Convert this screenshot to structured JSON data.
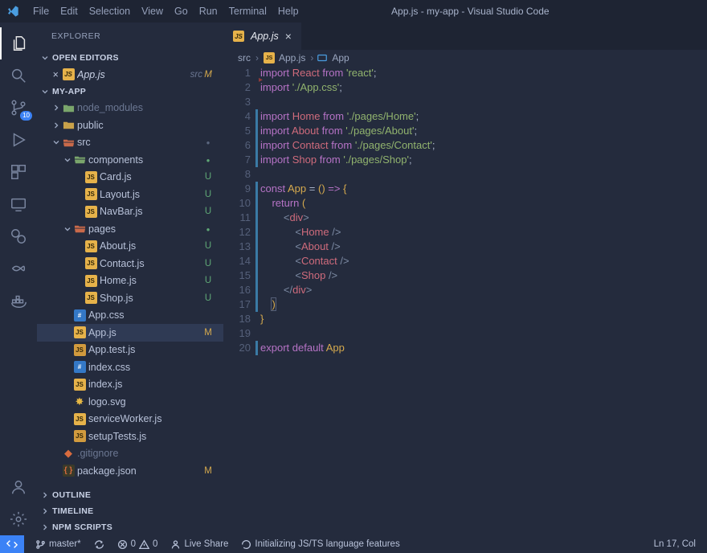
{
  "window": {
    "title": "App.js - my-app - Visual Studio Code"
  },
  "menubar": [
    "File",
    "Edit",
    "Selection",
    "View",
    "Go",
    "Run",
    "Terminal",
    "Help"
  ],
  "activitybar": {
    "scm_badge": "10",
    "items": [
      "explorer",
      "search",
      "scm",
      "run",
      "extensions",
      "remote",
      "cloud",
      "live-share",
      "docker"
    ],
    "bottom": [
      "accounts",
      "settings"
    ]
  },
  "sidebar": {
    "title": "EXPLORER",
    "sections": {
      "openEditors": "OPEN EDITORS",
      "project": "MY-APP",
      "outline": "OUTLINE",
      "timeline": "TIMELINE",
      "npm": "NPM SCRIPTS"
    },
    "openEditors": [
      {
        "name": "App.js",
        "desc": "src",
        "status": "M"
      }
    ],
    "tree": [
      {
        "d": 1,
        "c": "right",
        "ico": "folder-g",
        "lbl": "node_modules",
        "dim": true
      },
      {
        "d": 1,
        "c": "right",
        "ico": "folder-y",
        "lbl": "public"
      },
      {
        "d": 1,
        "c": "down",
        "ico": "folder-r-o",
        "lbl": "src",
        "badge": "dot"
      },
      {
        "d": 2,
        "c": "down",
        "ico": "folder-g-o",
        "lbl": "components",
        "badge": "gdot"
      },
      {
        "d": 3,
        "ico": "js",
        "lbl": "Card.js",
        "badge": "U"
      },
      {
        "d": 3,
        "ico": "js",
        "lbl": "Layout.js",
        "badge": "U"
      },
      {
        "d": 3,
        "ico": "js",
        "lbl": "NavBar.js",
        "badge": "U"
      },
      {
        "d": 2,
        "c": "down",
        "ico": "folder-r-o",
        "lbl": "pages",
        "badge": "gdot"
      },
      {
        "d": 3,
        "ico": "js",
        "lbl": "About.js",
        "badge": "U"
      },
      {
        "d": 3,
        "ico": "js",
        "lbl": "Contact.js",
        "badge": "U"
      },
      {
        "d": 3,
        "ico": "js",
        "lbl": "Home.js",
        "badge": "U"
      },
      {
        "d": 3,
        "ico": "js",
        "lbl": "Shop.js",
        "badge": "U"
      },
      {
        "d": 2,
        "ico": "css",
        "lbl": "App.css"
      },
      {
        "d": 2,
        "ico": "js",
        "lbl": "App.js",
        "badge": "M",
        "sel": true
      },
      {
        "d": 2,
        "ico": "jst",
        "lbl": "App.test.js"
      },
      {
        "d": 2,
        "ico": "css",
        "lbl": "index.css"
      },
      {
        "d": 2,
        "ico": "js",
        "lbl": "index.js"
      },
      {
        "d": 2,
        "ico": "star",
        "lbl": "logo.svg"
      },
      {
        "d": 2,
        "ico": "js",
        "lbl": "serviceWorker.js"
      },
      {
        "d": 2,
        "ico": "jst",
        "lbl": "setupTests.js"
      },
      {
        "d": 1,
        "ico": "git",
        "lbl": ".gitignore",
        "dim": true
      },
      {
        "d": 1,
        "ico": "json",
        "lbl": "package.json",
        "badge": "M"
      }
    ]
  },
  "tab": {
    "name": "App.js"
  },
  "breadcrumb": {
    "a": "src",
    "b": "App.js",
    "c": "App"
  },
  "code": {
    "bars": [
      [
        4,
        7
      ],
      [
        9,
        17
      ],
      [
        20,
        20
      ]
    ],
    "lines": [
      {
        "n": 1,
        "t": [
          [
            "kw",
            "import"
          ],
          [
            "",
            ""
          ],
          [
            "id",
            "React"
          ],
          [
            "",
            ""
          ],
          [
            "kw",
            "from"
          ],
          [
            "",
            ""
          ],
          [
            "str",
            "'react'"
          ],
          [
            "pn",
            ";"
          ]
        ]
      },
      {
        "n": 2,
        "t": [
          [
            "kw",
            "import"
          ],
          [
            "",
            ""
          ],
          [
            "str",
            "'./App.css'"
          ],
          [
            "pn",
            ";"
          ]
        ]
      },
      {
        "n": 3,
        "t": []
      },
      {
        "n": 4,
        "t": [
          [
            "kw",
            "import"
          ],
          [
            "",
            ""
          ],
          [
            "id",
            "Home"
          ],
          [
            "",
            ""
          ],
          [
            "kw",
            "from"
          ],
          [
            "",
            ""
          ],
          [
            "str",
            "'./pages/Home'"
          ],
          [
            "pn",
            ";"
          ]
        ]
      },
      {
        "n": 5,
        "t": [
          [
            "kw",
            "import"
          ],
          [
            "",
            ""
          ],
          [
            "id",
            "About"
          ],
          [
            "",
            ""
          ],
          [
            "kw",
            "from"
          ],
          [
            "",
            ""
          ],
          [
            "str",
            "'./pages/About'"
          ],
          [
            "pn",
            ";"
          ]
        ]
      },
      {
        "n": 6,
        "t": [
          [
            "kw",
            "import"
          ],
          [
            "",
            ""
          ],
          [
            "id",
            "Contact"
          ],
          [
            "",
            ""
          ],
          [
            "kw",
            "from"
          ],
          [
            "",
            ""
          ],
          [
            "str",
            "'./pages/Contact'"
          ],
          [
            "pn",
            ";"
          ]
        ]
      },
      {
        "n": 7,
        "t": [
          [
            "kw",
            "import"
          ],
          [
            "",
            ""
          ],
          [
            "id",
            "Shop"
          ],
          [
            "",
            ""
          ],
          [
            "kw",
            "from"
          ],
          [
            "",
            ""
          ],
          [
            "str",
            "'./pages/Shop'"
          ],
          [
            "pn",
            ";"
          ]
        ]
      },
      {
        "n": 8,
        "t": []
      },
      {
        "n": 9,
        "t": [
          [
            "kw",
            "const"
          ],
          [
            "",
            ""
          ],
          [
            "fn",
            "App"
          ],
          [
            "",
            ""
          ],
          [
            "pn",
            "="
          ],
          [
            "",
            ""
          ],
          [
            "par",
            "("
          ],
          [
            "par",
            ")"
          ],
          [
            "",
            ""
          ],
          [
            "op",
            "=>"
          ],
          [
            "",
            ""
          ],
          [
            "par",
            "{"
          ]
        ]
      },
      {
        "n": 10,
        "i": 4,
        "t": [
          [
            "kw",
            "return"
          ],
          [
            "",
            ""
          ],
          [
            "par",
            "("
          ]
        ]
      },
      {
        "n": 11,
        "i": 8,
        "t": [
          [
            "tagb",
            "<"
          ],
          [
            "tag",
            "div"
          ],
          [
            "tagb",
            ">"
          ]
        ]
      },
      {
        "n": 12,
        "i": 12,
        "t": [
          [
            "tagb",
            "<"
          ],
          [
            "tag",
            "Home"
          ],
          [
            "",
            ""
          ],
          [
            "tagb",
            "/>"
          ]
        ]
      },
      {
        "n": 13,
        "i": 12,
        "t": [
          [
            "tagb",
            "<"
          ],
          [
            "tag",
            "About"
          ],
          [
            "",
            ""
          ],
          [
            "tagb",
            "/>"
          ]
        ]
      },
      {
        "n": 14,
        "i": 12,
        "t": [
          [
            "tagb",
            "<"
          ],
          [
            "tag",
            "Contact"
          ],
          [
            "",
            ""
          ],
          [
            "tagb",
            "/>"
          ]
        ]
      },
      {
        "n": 15,
        "i": 12,
        "t": [
          [
            "tagb",
            "<"
          ],
          [
            "tag",
            "Shop"
          ],
          [
            "",
            ""
          ],
          [
            "tagb",
            "/>"
          ]
        ]
      },
      {
        "n": 16,
        "i": 8,
        "t": [
          [
            "tagb",
            "</"
          ],
          [
            "tag",
            "div"
          ],
          [
            "tagb",
            ">"
          ]
        ]
      },
      {
        "n": 17,
        "i": 4,
        "t": [
          [
            "par match",
            ")"
          ]
        ]
      },
      {
        "n": 18,
        "t": [
          [
            "par",
            "}"
          ]
        ]
      },
      {
        "n": 19,
        "t": []
      },
      {
        "n": 20,
        "t": [
          [
            "kw",
            "export"
          ],
          [
            "",
            ""
          ],
          [
            "kw",
            "default"
          ],
          [
            "",
            ""
          ],
          [
            "fn",
            "App"
          ]
        ]
      }
    ]
  },
  "status": {
    "branch": "master*",
    "errors": "0",
    "warnings": "0",
    "liveShare": "Live Share",
    "lang": "Initializing JS/TS language features",
    "pos": "Ln 17, Col"
  }
}
